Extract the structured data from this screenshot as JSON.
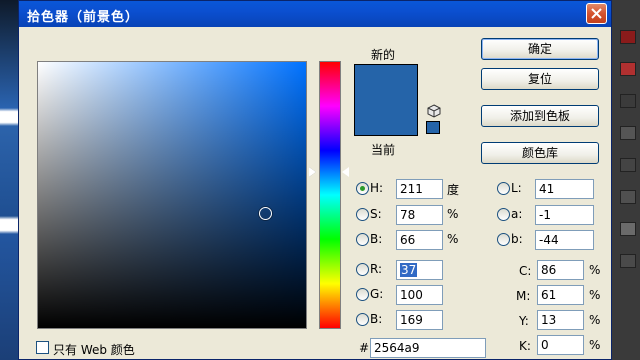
{
  "dialog": {
    "title": "拾色器（前景色）",
    "close_label": "✕"
  },
  "preview": {
    "new_label": "新的",
    "current_label": "当前",
    "new_color": "#2564a9",
    "current_color": "#2564a9"
  },
  "buttons": {
    "ok": "确定",
    "reset": "复位",
    "add_to_swatches": "添加到色板",
    "color_libraries": "颜色库"
  },
  "hsb": {
    "h": {
      "label": "H:",
      "value": "211",
      "unit": "度",
      "selected": true
    },
    "s": {
      "label": "S:",
      "value": "78",
      "unit": "%"
    },
    "b": {
      "label": "B:",
      "value": "66",
      "unit": "%"
    }
  },
  "rgb": {
    "r": {
      "label": "R:",
      "value": "37"
    },
    "g": {
      "label": "G:",
      "value": "100"
    },
    "b": {
      "label": "B:",
      "value": "169"
    }
  },
  "lab": {
    "l": {
      "label": "L:",
      "value": "41"
    },
    "a": {
      "label": "a:",
      "value": "-1"
    },
    "b": {
      "label": "b:",
      "value": "-44"
    }
  },
  "cmyk": {
    "c": {
      "label": "C:",
      "value": "86",
      "unit": "%"
    },
    "m": {
      "label": "M:",
      "value": "61",
      "unit": "%"
    },
    "y": {
      "label": "Y:",
      "value": "13",
      "unit": "%"
    },
    "k": {
      "label": "K:",
      "value": "0",
      "unit": "%"
    }
  },
  "hex": {
    "label": "#",
    "value": "2564a9"
  },
  "web_only": {
    "label": "只有 Web 颜色",
    "checked": false
  },
  "colors": {
    "title_bar": "#0b4fd0",
    "dialog_bg": "#ece9d8",
    "field_hue": "#0072ff"
  }
}
